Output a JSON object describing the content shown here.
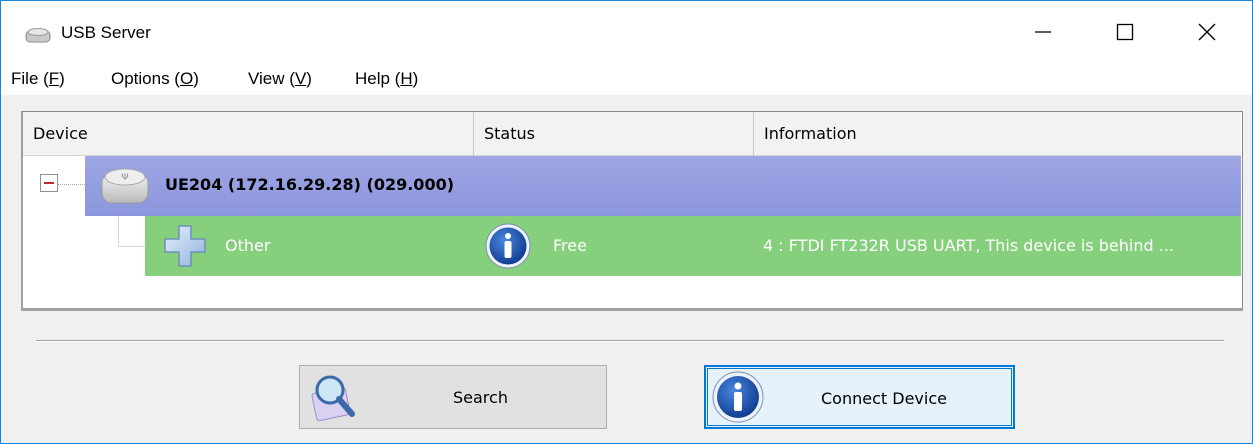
{
  "window": {
    "title": "USB Server",
    "icons": {
      "app": "usb-hub-icon",
      "minimize": "minimize-icon",
      "maximize": "maximize-icon",
      "close": "close-icon"
    }
  },
  "menu": {
    "file": {
      "text": "File (",
      "key": "F",
      "end": ")"
    },
    "options": {
      "text": "Options (",
      "key": "O",
      "end": ")"
    },
    "view": {
      "text": "View (",
      "key": "V",
      "end": ")"
    },
    "help": {
      "text": "Help (",
      "key": "H",
      "end": ")"
    }
  },
  "list": {
    "columns": [
      "Device",
      "Status",
      "Information"
    ],
    "server": {
      "label": "UE204  (172.16.29.28) (029.000)",
      "color": "#959ee0"
    },
    "device": {
      "name": "Other",
      "status": "Free",
      "information": "4 : FTDI FT232R USB UART, This device is behind ...",
      "color": "#86cf7d"
    }
  },
  "buttons": {
    "search": "Search",
    "connect": "Connect Device"
  },
  "colors": {
    "accent": "#0078d7",
    "server_row": "#959ee0",
    "device_row": "#86cf7d"
  }
}
